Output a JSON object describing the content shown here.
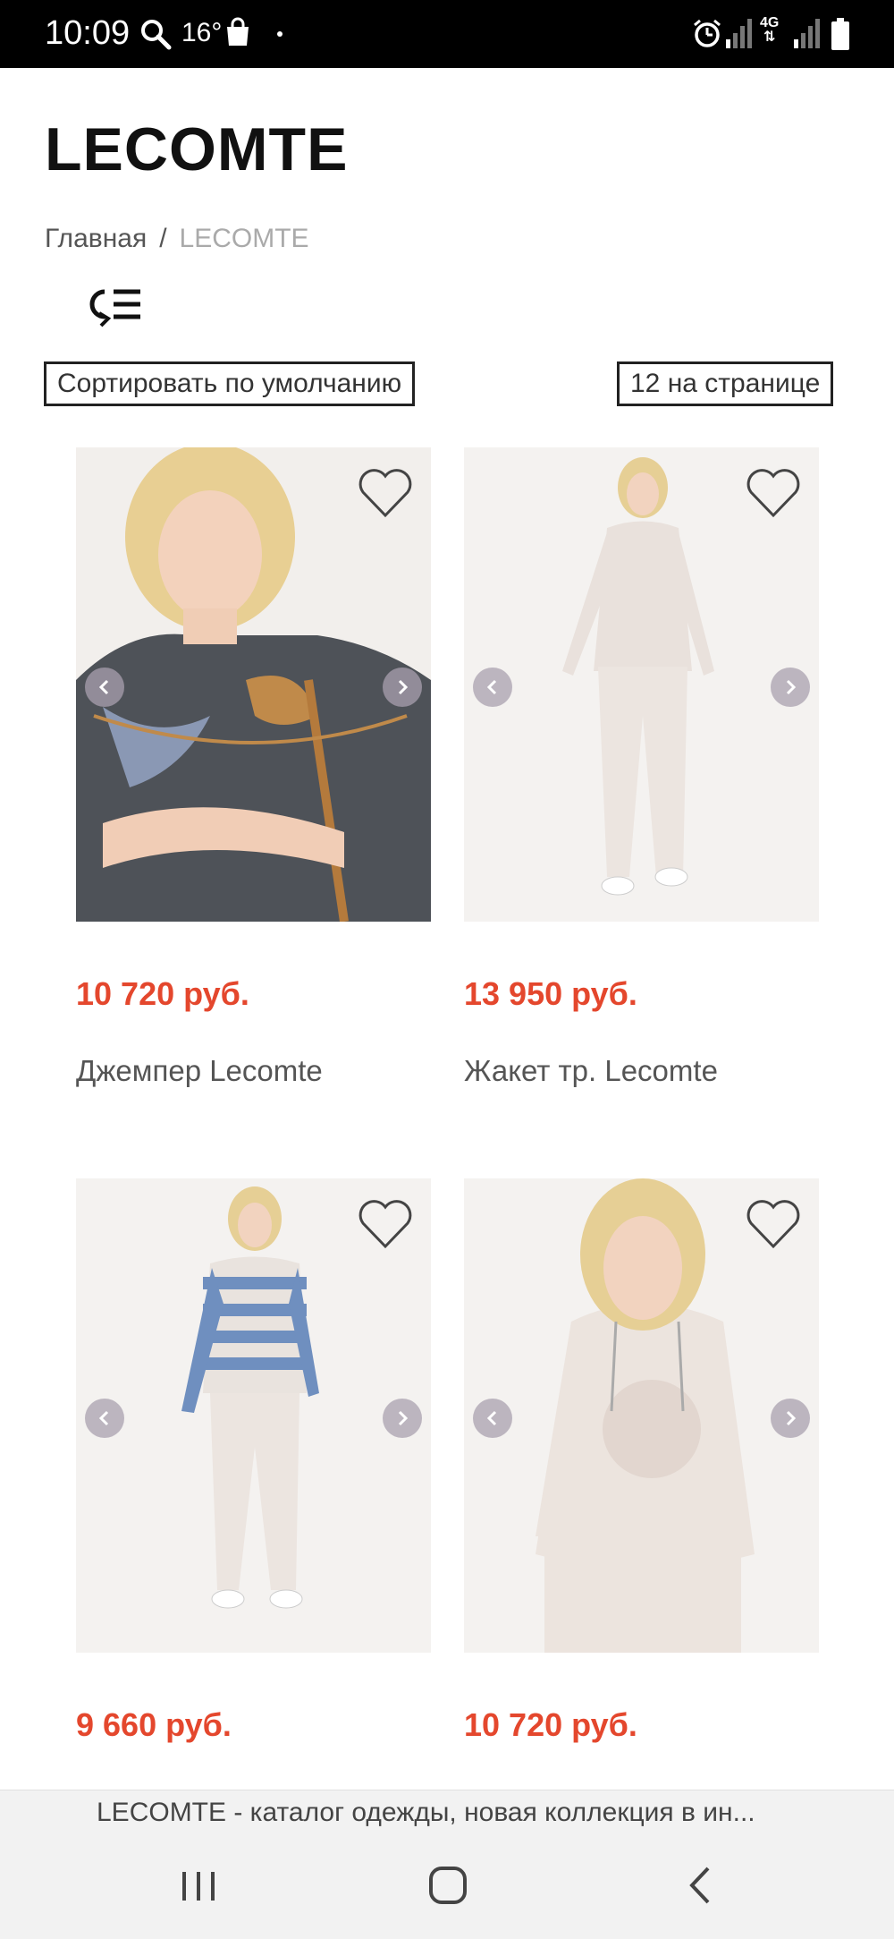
{
  "status_bar": {
    "time": "10:09",
    "temperature": "16°",
    "network": "4G"
  },
  "header": {
    "title": "LECOMTE"
  },
  "breadcrumb": {
    "home": "Главная",
    "separator": "/",
    "current": "LECOMTE"
  },
  "controls": {
    "sort_label": "Сортировать по умолчанию",
    "per_page_label": "12 на странице"
  },
  "products": [
    {
      "price": "10 720 руб.",
      "name": "Джемпер Lecomte"
    },
    {
      "price": "13 950 руб.",
      "name": "Жакет тр. Lecomte"
    },
    {
      "price": "9 660 руб.",
      "name": ""
    },
    {
      "price": "10 720 руб.",
      "name": ""
    }
  ],
  "browser": {
    "page_title": "LECOMTE - каталог одежды, новая коллекция в ин..."
  },
  "colors": {
    "price": "#e4472d",
    "status_bar": "#000000",
    "nav_bar": "#f2f2f2"
  }
}
